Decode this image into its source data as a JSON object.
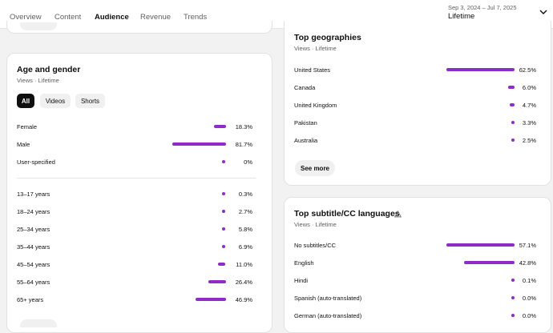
{
  "tabs": [
    {
      "label": "Overview"
    },
    {
      "label": "Content"
    },
    {
      "label": "Audience",
      "active": true
    },
    {
      "label": "Revenue"
    },
    {
      "label": "Trends"
    }
  ],
  "period": {
    "date_range": "Sep 3, 2024 – Jul 7, 2025",
    "label": "Lifetime"
  },
  "accent_color": "#8e2cc7",
  "age_gender": {
    "title": "Age and gender",
    "subtitle": "Views · Lifetime",
    "filters": [
      "All",
      "Videos",
      "Shorts"
    ],
    "gender": [
      {
        "label": "Female",
        "value": "18.3%"
      },
      {
        "label": "Male",
        "value": "81.7%"
      },
      {
        "label": "User-specified",
        "value": "0%"
      }
    ],
    "ages": [
      {
        "label": "13–17 years",
        "value": "0.3%"
      },
      {
        "label": "18–24 years",
        "value": "2.7%"
      },
      {
        "label": "25–34 years",
        "value": "5.8%"
      },
      {
        "label": "35–44 years",
        "value": "6.9%"
      },
      {
        "label": "45–54 years",
        "value": "11.0%"
      },
      {
        "label": "55–64 years",
        "value": "26.4%"
      },
      {
        "label": "65+ years",
        "value": "46.9%"
      }
    ]
  },
  "geographies": {
    "title": "Top geographies",
    "subtitle": "Views · Lifetime",
    "rows": [
      {
        "label": "United States",
        "value": "62.5%"
      },
      {
        "label": "Canada",
        "value": "6.0%"
      },
      {
        "label": "United Kingdom",
        "value": "4.7%"
      },
      {
        "label": "Pakistan",
        "value": "3.3%"
      },
      {
        "label": "Australia",
        "value": "2.5%"
      }
    ],
    "see_more": "See more"
  },
  "languages": {
    "title": "Top subtitle/CC languages",
    "subtitle": "Views · Lifetime",
    "rows": [
      {
        "label": "No subtitles/CC",
        "value": "57.1%"
      },
      {
        "label": "English",
        "value": "42.8%"
      },
      {
        "label": "Hindi",
        "value": "0.1%"
      },
      {
        "label": "Spanish (auto-translated)",
        "value": "0.0%"
      },
      {
        "label": "German (auto-translated)",
        "value": "0.0%"
      }
    ]
  }
}
